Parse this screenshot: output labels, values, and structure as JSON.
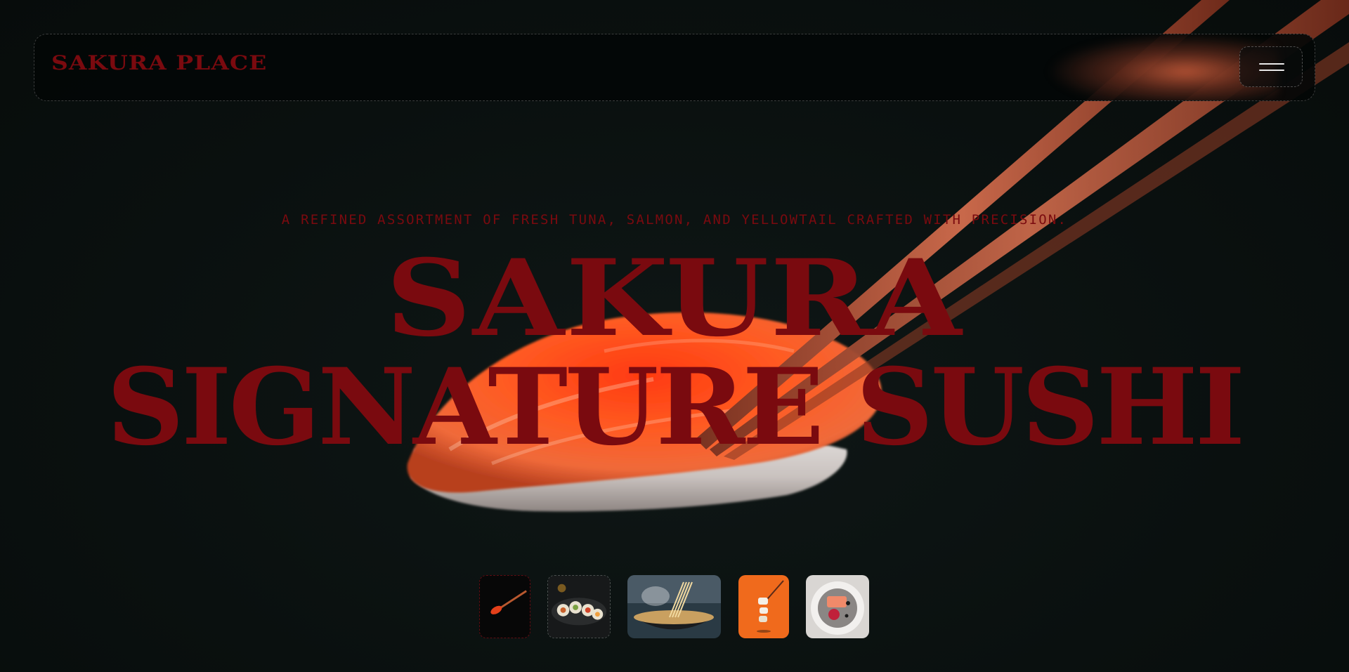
{
  "header": {
    "logo_text": "SAKURA PLACE",
    "menu_icon": "hamburger-menu-icon"
  },
  "hero": {
    "tagline": "A REFINED ASSORTMENT OF FRESH TUNA, SALMON, AND YELLOWTAIL CRAFTED WITH PRECISION.",
    "title_line_1": "SAKURA",
    "title_line_2": "SIGNATURE SUSHI"
  },
  "thumbnails": [
    {
      "name": "spoon-with-roe",
      "selected": true
    },
    {
      "name": "sushi-rolls-platter",
      "selected": false
    },
    {
      "name": "ramen-noodles",
      "selected": false
    },
    {
      "name": "sushi-stack-chopsticks",
      "selected": false
    },
    {
      "name": "plated-salmon-dish",
      "selected": false
    }
  ],
  "colors": {
    "background": "#0b1211",
    "accent_red": "#7a0a0f",
    "salmon": "#ff4a1a",
    "chopstick": "#b85a3a"
  }
}
